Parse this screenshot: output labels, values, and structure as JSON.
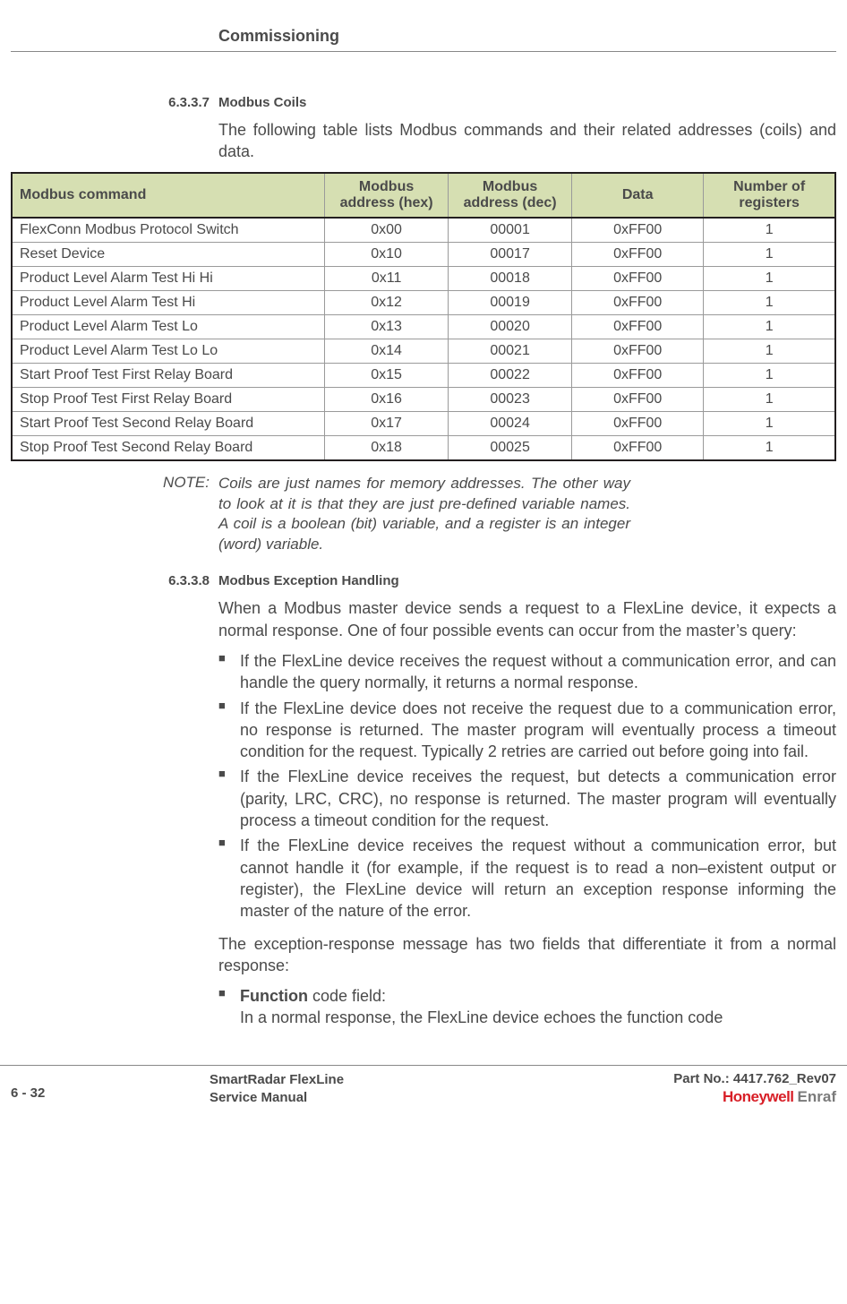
{
  "header": {
    "chapter": "Commissioning"
  },
  "sec1": {
    "num": "6.3.3.7",
    "title": "Modbus Coils",
    "intro": "The following table lists Modbus commands and their related addresses (coils) and data."
  },
  "table": {
    "headers": {
      "c0": "Modbus command",
      "c1": "Modbus address (hex)",
      "c2": "Modbus address (dec)",
      "c3": "Data",
      "c4": "Number of registers"
    },
    "rows": [
      {
        "c0": "FlexConn Modbus Protocol Switch",
        "c1": "0x00",
        "c2": "00001",
        "c3": "0xFF00",
        "c4": "1"
      },
      {
        "c0": "Reset Device",
        "c1": "0x10",
        "c2": "00017",
        "c3": "0xFF00",
        "c4": "1"
      },
      {
        "c0": "Product Level Alarm Test Hi Hi",
        "c1": "0x11",
        "c2": "00018",
        "c3": "0xFF00",
        "c4": "1"
      },
      {
        "c0": "Product Level Alarm Test Hi",
        "c1": "0x12",
        "c2": "00019",
        "c3": "0xFF00",
        "c4": "1"
      },
      {
        "c0": "Product Level Alarm Test Lo",
        "c1": "0x13",
        "c2": "00020",
        "c3": "0xFF00",
        "c4": "1"
      },
      {
        "c0": "Product Level Alarm Test Lo Lo",
        "c1": "0x14",
        "c2": "00021",
        "c3": "0xFF00",
        "c4": "1"
      },
      {
        "c0": "Start Proof Test First Relay Board",
        "c1": "0x15",
        "c2": "00022",
        "c3": "0xFF00",
        "c4": "1"
      },
      {
        "c0": "Stop Proof Test First Relay Board",
        "c1": "0x16",
        "c2": "00023",
        "c3": "0xFF00",
        "c4": "1"
      },
      {
        "c0": "Start Proof Test Second Relay Board",
        "c1": "0x17",
        "c2": "00024",
        "c3": "0xFF00",
        "c4": "1"
      },
      {
        "c0": "Stop Proof Test Second Relay Board",
        "c1": "0x18",
        "c2": "00025",
        "c3": "0xFF00",
        "c4": "1"
      }
    ]
  },
  "note": {
    "label": "NOTE:",
    "text": "Coils are just names for memory addresses. The other way to look at it is that they are just pre-defined variable names. A coil is a boolean (bit) variable, and a register is an integer (word) variable."
  },
  "sec2": {
    "num": "6.3.3.8",
    "title": "Modbus Exception Handling",
    "p1": "When a Modbus master device sends a request to a FlexLine device, it expects a normal response. One of four possible events can occur from the master’s query:",
    "bullets": [
      "If the FlexLine device receives the request without a communication error, and can handle the query normally, it returns a normal response.",
      "If the FlexLine device does not receive the request due to a communication error, no response is returned. The master program will eventually process a timeout condition for the request. Typically 2 retries are carried out before going into fail.",
      "If the FlexLine device receives the request, but detects a communication error (parity, LRC, CRC), no response is returned. The master program will eventually process a timeout condition for the request.",
      "If the FlexLine device receives the request without a communication error, but cannot handle it (for example, if the request is to read a non–existent output or register), the FlexLine device will return an exception response informing the master of the nature of the error."
    ],
    "p2": "The exception-response message has two fields that differentiate it from a normal response:",
    "fn_label": "Function",
    "fn_rest": " code field:",
    "fn_body": "In a normal response, the FlexLine device echoes the function code"
  },
  "footer": {
    "page": "6 - 32",
    "title1": "SmartRadar FlexLine",
    "title2": "Service Manual",
    "part": "Part No.: 4417.762_Rev07",
    "brand1": "Honeywell",
    "brand2": "Enraf"
  }
}
